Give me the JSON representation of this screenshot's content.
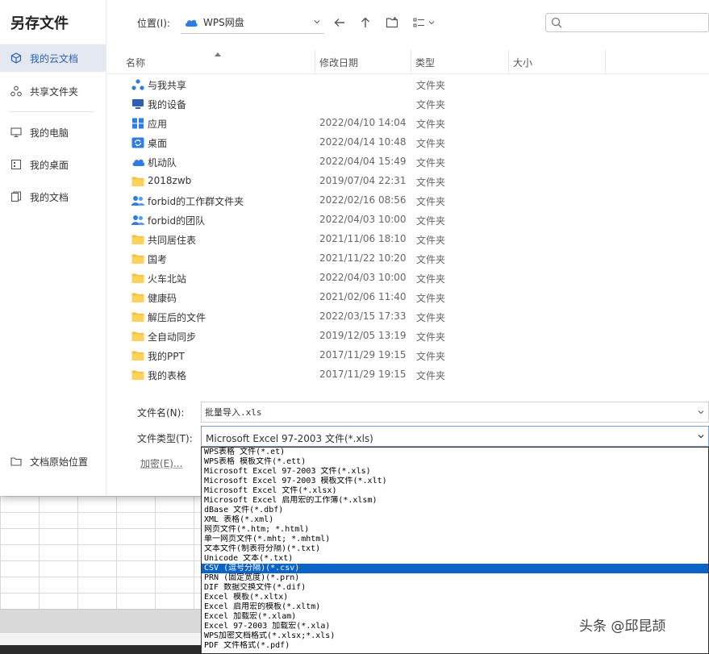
{
  "dialog": {
    "title": "另存文件"
  },
  "sidebar": {
    "items": [
      {
        "label": "我的云文档",
        "icon": "cube-icon",
        "active": true
      },
      {
        "label": "共享文件夹",
        "icon": "share-icon"
      },
      {
        "label": "我的电脑",
        "icon": "monitor-icon"
      },
      {
        "label": "我的桌面",
        "icon": "desktop-icon"
      },
      {
        "label": "我的文档",
        "icon": "document-icon"
      }
    ],
    "home_location": "文档原始位置"
  },
  "toolbar": {
    "location_label": "位置(I):",
    "location_value": "WPS网盘",
    "search_placeholder": ""
  },
  "columns": {
    "name": "名称",
    "modified": "修改日期",
    "type": "类型",
    "size": "大小"
  },
  "files": [
    {
      "name": "与我共享",
      "date": "",
      "type": "文件夹",
      "icon": "share-folder-icon"
    },
    {
      "name": "我的设备",
      "date": "",
      "type": "文件夹",
      "icon": "device-folder-icon"
    },
    {
      "name": "应用",
      "date": "2022/04/10 14:04",
      "type": "文件夹",
      "icon": "apps-folder-icon"
    },
    {
      "name": "桌面",
      "date": "2022/04/14 10:48",
      "type": "文件夹",
      "icon": "sync-desktop-icon"
    },
    {
      "name": "机动队",
      "date": "2022/04/04 15:49",
      "type": "文件夹",
      "icon": "cloud-folder-icon"
    },
    {
      "name": "2018zwb",
      "date": "2019/07/04 22:31",
      "type": "文件夹",
      "icon": "folder-icon"
    },
    {
      "name": "forbid的工作群文件夹",
      "date": "2022/02/16 08:56",
      "type": "文件夹",
      "icon": "group-folder-icon"
    },
    {
      "name": "forbid的团队",
      "date": "2022/04/03 10:00",
      "type": "文件夹",
      "icon": "group-folder-icon"
    },
    {
      "name": "共同居住表",
      "date": "2021/11/06 18:10",
      "type": "文件夹",
      "icon": "folder-icon"
    },
    {
      "name": "国考",
      "date": "2021/11/22 10:20",
      "type": "文件夹",
      "icon": "folder-icon"
    },
    {
      "name": "火车北站",
      "date": "2022/04/03 10:00",
      "type": "文件夹",
      "icon": "folder-icon"
    },
    {
      "name": "健康码",
      "date": "2021/02/06 11:40",
      "type": "文件夹",
      "icon": "folder-icon"
    },
    {
      "name": "解压后的文件",
      "date": "2022/03/15 17:33",
      "type": "文件夹",
      "icon": "folder-icon"
    },
    {
      "name": "全自动同步",
      "date": "2019/12/05 13:19",
      "type": "文件夹",
      "icon": "folder-icon"
    },
    {
      "name": "我的PPT",
      "date": "2017/11/29 19:15",
      "type": "文件夹",
      "icon": "folder-icon"
    },
    {
      "name": "我的表格",
      "date": "2017/11/29 19:15",
      "type": "文件夹",
      "icon": "folder-icon"
    }
  ],
  "form": {
    "filename_label": "文件名(N):",
    "filename_value": "批量导入.xls",
    "filetype_label": "文件类型(T):",
    "filetype_value": "Microsoft Excel 97-2003 文件(*.xls)",
    "encrypt_label": "加密(E)..."
  },
  "filetype_options": [
    {
      "label": "WPS表格 文件(*.et)"
    },
    {
      "label": "WPS表格 模板文件(*.ett)"
    },
    {
      "label": "Microsoft Excel 97-2003 文件(*.xls)"
    },
    {
      "label": "Microsoft Excel 97-2003 模板文件(*.xlt)"
    },
    {
      "label": "Microsoft Excel 文件(*.xlsx)"
    },
    {
      "label": "Microsoft Excel 启用宏的工作簿(*.xlsm)"
    },
    {
      "label": "dBase 文件(*.dbf)"
    },
    {
      "label": "XML 表格(*.xml)"
    },
    {
      "label": "网页文件(*.htm; *.html)"
    },
    {
      "label": "单一网页文件(*.mht; *.mhtml)"
    },
    {
      "label": "文本文件(制表符分隔)(*.txt)"
    },
    {
      "label": "Unicode 文本(*.txt)"
    },
    {
      "label": "CSV (逗号分隔)(*.csv)",
      "selected": true
    },
    {
      "label": "PRN (固定宽度)(*.prn)"
    },
    {
      "label": "DIF 数据交换文件(*.dif)"
    },
    {
      "label": "Excel 模板(*.xltx)"
    },
    {
      "label": "Excel 启用宏的模板(*.xltm)"
    },
    {
      "label": "Excel 加载宏(*.xlam)"
    },
    {
      "label": "Excel 97-2003 加载宏(*.xla)"
    },
    {
      "label": "WPS加密文档格式(*.xlsx;*.xls)"
    },
    {
      "label": "PDF 文件格式(*.pdf)"
    }
  ],
  "watermark": "头条 @邱昆颉",
  "colors": {
    "accent": "#2f5fb3",
    "selection": "#0a64c8",
    "folder": "#f5c040"
  }
}
